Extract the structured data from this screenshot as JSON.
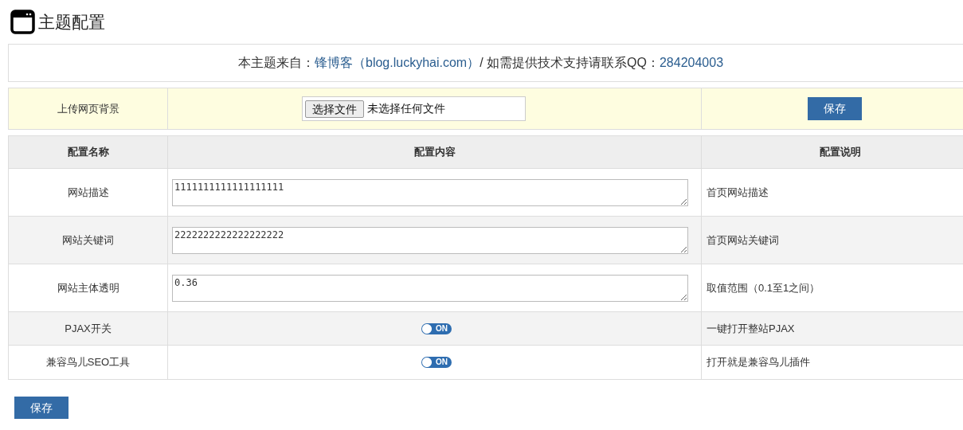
{
  "title": "主题配置",
  "info": [
    {
      "kind": "text",
      "text": "本主题来自："
    },
    {
      "kind": "link",
      "text": "锋博客（blog.luckyhai.com）"
    },
    {
      "kind": "text",
      "text": "/ 如需提供技术支持请联系QQ："
    },
    {
      "kind": "link",
      "text": "284204003"
    }
  ],
  "upload": {
    "label": "上传网页背景",
    "button": "选择文件",
    "status": "未选择任何文件",
    "save": "保存"
  },
  "table": {
    "columns": [
      "配置名称",
      "配置内容",
      "配置说明"
    ],
    "rows": [
      {
        "name": "网站描述",
        "kind": "text",
        "value": "1111111111111111111",
        "note": "首页网站描述"
      },
      {
        "name": "网站关键词",
        "kind": "text",
        "value": "2222222222222222222",
        "note": "首页网站关键词"
      },
      {
        "name": "网站主体透明",
        "kind": "text",
        "value": "0.36",
        "note": "取值范围（0.1至1之间）"
      },
      {
        "name": "PJAX开关",
        "kind": "toggle",
        "on": true,
        "label": "ON",
        "note": "一键打开整站PJAX"
      },
      {
        "name": "兼容鸟儿SEO工具",
        "kind": "toggle",
        "on": true,
        "label": "ON",
        "note": "打开就是兼容鸟儿插件"
      }
    ]
  },
  "save": "保存"
}
